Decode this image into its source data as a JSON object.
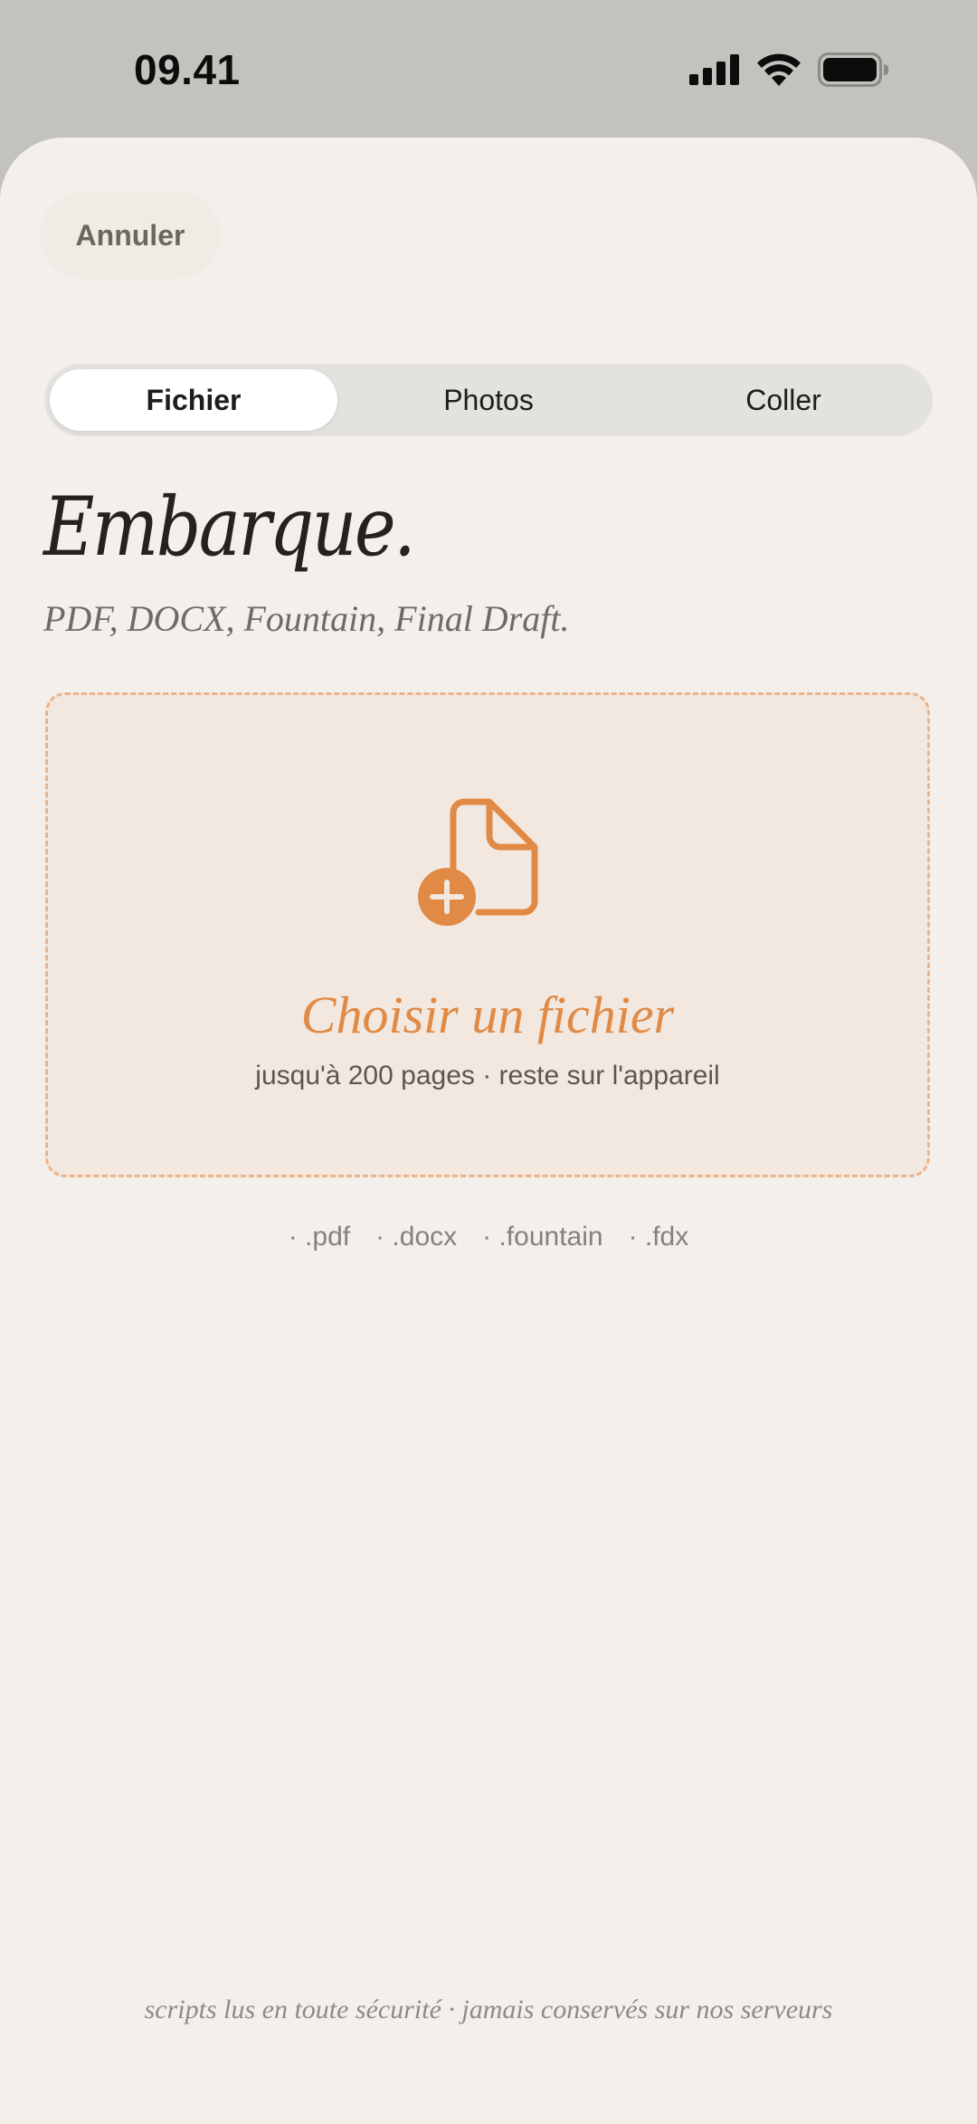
{
  "status_bar": {
    "time": "09.41",
    "signal_icon": "cellular-signal-icon",
    "wifi_icon": "wifi-icon",
    "battery_icon": "battery-icon"
  },
  "header": {
    "cancel_label": "Annuler"
  },
  "tabs": [
    {
      "label": "Fichier",
      "active": true
    },
    {
      "label": "Photos",
      "active": false
    },
    {
      "label": "Coller",
      "active": false
    }
  ],
  "main": {
    "title": "Embarque.",
    "subtitle": "PDF, DOCX, Fountain, Final Draft."
  },
  "dropzone": {
    "icon": "file-add-icon",
    "cta": "Choisir un fichier",
    "hint": "jusqu'à 200 pages · reste sur l'appareil"
  },
  "formats": [
    "· .pdf",
    "· .docx",
    "· .fountain",
    "· .fdx"
  ],
  "footer": {
    "note": "scripts lus en toute sécurité · jamais conservés sur nos serveurs"
  },
  "colors": {
    "accent": "#e08a45",
    "dropzone_border": "#edb389",
    "sheet_background": "#f3f0eb",
    "status_background": "#c3c2bd"
  }
}
